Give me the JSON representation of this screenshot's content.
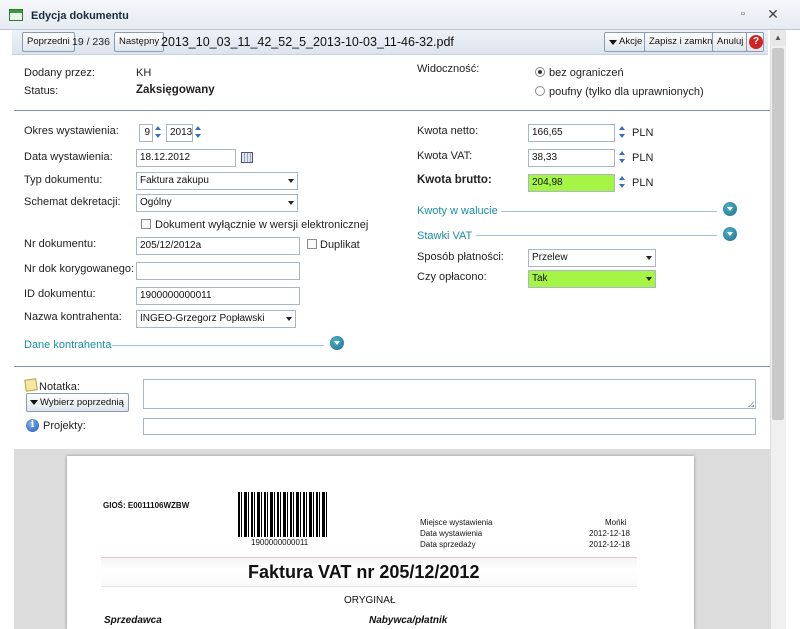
{
  "window": {
    "title": "Edycja dokumentu",
    "icon": "form-window-icon",
    "maximize_glyph": "▫",
    "close_glyph": "✕"
  },
  "toolbar": {
    "prev_label": "Poprzedni",
    "pager": "19 / 236",
    "next_label": "Następny",
    "filename": "2013_10_03_11_42_52_5_2013-10-03_11-46-32.pdf",
    "actions_label": "Akcje",
    "save_close_label": "Zapisz i zamknij",
    "cancel_label": "Anuluj",
    "help_glyph": "?"
  },
  "header": {
    "added_by_label": "Dodany przez:",
    "added_by_value": "KH",
    "status_label": "Status:",
    "status_value": "Zaksięgowany",
    "visibility_label": "Widoczność:",
    "visibility_options": [
      "bez ograniczeń",
      "poufny (tylko dla uprawnionych)"
    ],
    "visibility_selected": "bez ograniczeń"
  },
  "left_form": {
    "period_label": "Okres wystawienia:",
    "period_month": "9",
    "period_year": "2013",
    "issue_date_label": "Data wystawienia:",
    "issue_date_value": "18.12.2012",
    "doc_type_label": "Typ dokumentu:",
    "doc_type_value": "Faktura zakupu",
    "scheme_label": "Schemat dekretacji:",
    "scheme_value": "Ogólny",
    "electronic_only_label": "Dokument wyłącznie w wersji elektronicznej",
    "electronic_only_checked": false,
    "doc_number_label": "Nr dokumentu:",
    "doc_number_value": "205/12/2012a",
    "duplicate_label": "Duplikat",
    "duplicate_checked": false,
    "correction_label": "Nr dok korygowanego:",
    "correction_value": "",
    "doc_id_label": "ID dokumentu:",
    "doc_id_value": "1900000000011",
    "contractor_label": "Nazwa kontrahenta:",
    "contractor_value": "INGEO-Grzegorz Popławski",
    "contractor_section": "Dane kontrahenta"
  },
  "right_form": {
    "net_label": "Kwota netto:",
    "net_value": "166,65",
    "vat_label": "Kwota VAT:",
    "vat_value": "38,33",
    "gross_label": "Kwota brutto:",
    "gross_value": "204,98",
    "currency": "PLN",
    "foreign_section": "Kwoty w walucie",
    "vat_rates_section": "Stawki VAT",
    "payment_method_label": "Sposób płatności:",
    "payment_method_value": "Przelew",
    "paid_label": "Czy opłacono:",
    "paid_value": "Tak",
    "highlight_color": "#a4f545"
  },
  "notes": {
    "note_label": "Notatka:",
    "choose_prev_label": "Wybierz poprzednią",
    "note_value": "",
    "projects_label": "Projekty:",
    "projects_value": ""
  },
  "preview": {
    "gios": "GIOŚ: E0011106WZBW",
    "barcode_number": "1900000000011",
    "place_label": "Miejsce wystawienia",
    "place_value": "Mońki",
    "issue_label": "Data wystawienia",
    "issue_value": "2012-12-18",
    "sale_label": "Data sprzedaży",
    "sale_value": "2012-12-18",
    "invoice_title": "Faktura VAT nr 205/12/2012",
    "original": "ORYGINAŁ",
    "seller": "Sprzedawca",
    "buyer": "Nabywca/płatnik"
  }
}
